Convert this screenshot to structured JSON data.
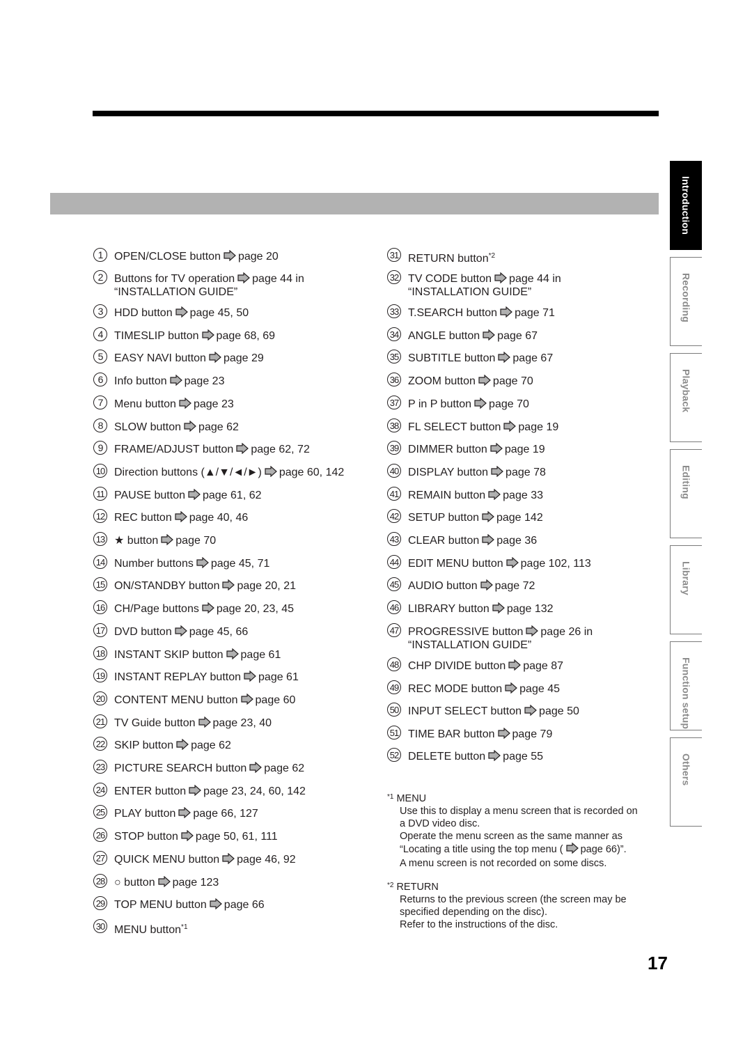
{
  "page_number": "17",
  "side_tabs": [
    {
      "label": "Introduction",
      "active": true
    },
    {
      "label": "Recording",
      "active": false
    },
    {
      "label": "Playback",
      "active": false
    },
    {
      "label": "Editing",
      "active": false
    },
    {
      "label": "Library",
      "active": false
    },
    {
      "label": "Function setup",
      "active": false
    },
    {
      "label": "Others",
      "active": false
    }
  ],
  "items_left": [
    {
      "num": "1",
      "label": "OPEN/CLOSE button",
      "ref": "page 20"
    },
    {
      "num": "2",
      "label": "Buttons for TV operation",
      "ref": "page 44 in",
      "line2": "“INSTALLATION GUIDE”"
    },
    {
      "num": "3",
      "label": "HDD button",
      "ref": "page 45, 50"
    },
    {
      "num": "4",
      "label": "TIMESLIP button",
      "ref": "page 68, 69"
    },
    {
      "num": "5",
      "label": "EASY NAVI button",
      "ref": "page 29"
    },
    {
      "num": "6",
      "label": "Info button",
      "ref": "page 23"
    },
    {
      "num": "7",
      "label": "Menu button",
      "ref": "page 23"
    },
    {
      "num": "8",
      "label": "SLOW button",
      "ref": "page 62"
    },
    {
      "num": "9",
      "label": "FRAME/ADJUST button",
      "ref": "page 62, 72"
    },
    {
      "num": "10",
      "label": "Direction buttons (▲/▼/◄/►)",
      "ref": "page 60, 142"
    },
    {
      "num": "11",
      "label": "PAUSE button",
      "ref": "page 61, 62"
    },
    {
      "num": "12",
      "label": "REC button",
      "ref": "page 40, 46"
    },
    {
      "num": "13",
      "label": "★ button",
      "ref": "page 70"
    },
    {
      "num": "14",
      "label": "Number buttons",
      "ref": "page 45, 71"
    },
    {
      "num": "15",
      "label": "ON/STANDBY button",
      "ref": "page 20, 21"
    },
    {
      "num": "16",
      "label": "CH/Page buttons",
      "ref": "page 20, 23, 45"
    },
    {
      "num": "17",
      "label": "DVD button",
      "ref": "page 45, 66"
    },
    {
      "num": "18",
      "label": "INSTANT SKIP button",
      "ref": "page 61"
    },
    {
      "num": "19",
      "label": "INSTANT REPLAY button",
      "ref": "page 61"
    },
    {
      "num": "20",
      "label": "CONTENT MENU button",
      "ref": "page 60"
    },
    {
      "num": "21",
      "label": "TV Guide button",
      "ref": "page 23, 40"
    },
    {
      "num": "22",
      "label": "SKIP button",
      "ref": "page 62"
    },
    {
      "num": "23",
      "label": "PICTURE SEARCH button",
      "ref": "page 62"
    },
    {
      "num": "24",
      "label": "ENTER button",
      "ref": "page 23, 24, 60, 142"
    },
    {
      "num": "25",
      "label": "PLAY button",
      "ref": "page 66, 127"
    },
    {
      "num": "26",
      "label": "STOP button",
      "ref": "page 50, 61, 111"
    },
    {
      "num": "27",
      "label": "QUICK MENU button",
      "ref": "page 46, 92"
    },
    {
      "num": "28",
      "label": "○ button",
      "ref": "page 123"
    },
    {
      "num": "29",
      "label": "TOP MENU button",
      "ref": "page 66"
    },
    {
      "num": "30",
      "label": "MENU button",
      "sup": "*1"
    }
  ],
  "items_right": [
    {
      "num": "31",
      "label": "RETURN button",
      "sup": "*2"
    },
    {
      "num": "32",
      "label": "TV CODE button",
      "ref": "page 44 in",
      "line2": "“INSTALLATION GUIDE”"
    },
    {
      "num": "33",
      "label": "T.SEARCH button",
      "ref": "page 71"
    },
    {
      "num": "34",
      "label": "ANGLE button",
      "ref": "page 67"
    },
    {
      "num": "35",
      "label": "SUBTITLE button",
      "ref": "page 67"
    },
    {
      "num": "36",
      "label": "ZOOM button",
      "ref": "page 70"
    },
    {
      "num": "37",
      "label": "P in P button",
      "ref": "page 70"
    },
    {
      "num": "38",
      "label": "FL SELECT button",
      "ref": "page 19"
    },
    {
      "num": "39",
      "label": "DIMMER button",
      "ref": "page 19"
    },
    {
      "num": "40",
      "label": "DISPLAY button",
      "ref": "page 78"
    },
    {
      "num": "41",
      "label": "REMAIN button",
      "ref": "page 33"
    },
    {
      "num": "42",
      "label": "SETUP button",
      "ref": "page 142"
    },
    {
      "num": "43",
      "label": "CLEAR button",
      "ref": "page 36"
    },
    {
      "num": "44",
      "label": "EDIT MENU button",
      "ref": "page 102, 113"
    },
    {
      "num": "45",
      "label": "AUDIO button",
      "ref": "page 72"
    },
    {
      "num": "46",
      "label": "LIBRARY button",
      "ref": "page 132"
    },
    {
      "num": "47",
      "label": "PROGRESSIVE button",
      "ref": "page 26 in",
      "line2": "“INSTALLATION GUIDE”"
    },
    {
      "num": "48",
      "label": "CHP DIVIDE button",
      "ref": "page 87"
    },
    {
      "num": "49",
      "label": "REC MODE button",
      "ref": "page 45"
    },
    {
      "num": "50",
      "label": "INPUT SELECT button",
      "ref": "page 50"
    },
    {
      "num": "51",
      "label": "TIME BAR button",
      "ref": "page 79"
    },
    {
      "num": "52",
      "label": "DELETE button",
      "ref": "page 55"
    }
  ],
  "footnotes": {
    "fn1": {
      "mark": "*1",
      "title": "MENU",
      "line1": "Use this to display a menu screen that is recorded on",
      "line2": "a DVD video disc.",
      "line3": "Operate the menu screen as the same manner as",
      "line4_pre": "“Locating a title using the top menu (",
      "line4_ref": "page 66)”.",
      "line5": "A menu screen is not recorded on some discs."
    },
    "fn2": {
      "mark": "*2",
      "title": "RETURN",
      "line1": "Returns to the previous screen (the screen may be",
      "line2": "specified depending on the disc).",
      "line3": "Refer to the instructions of the disc."
    }
  }
}
